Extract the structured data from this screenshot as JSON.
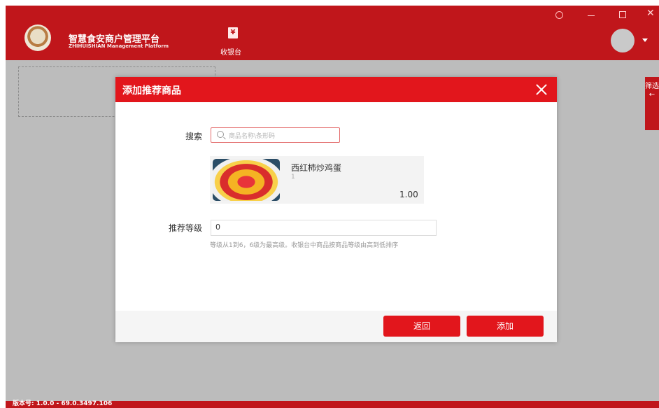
{
  "header": {
    "brand_cn": "智慧食安商户管理平台",
    "brand_en": "ZHIHUISHIAN Management Platform",
    "nav": {
      "icon": "cashier-icon",
      "icon_glyph": "¥",
      "label": "收银台"
    }
  },
  "side_tab": {
    "label": "筛选"
  },
  "footer": {
    "version": "版本号: 1.0.0 - 69.0.3497.106"
  },
  "modal": {
    "title": "添加推荐商品",
    "search": {
      "label": "搜索",
      "placeholder": "商品名称\\条形码"
    },
    "product": {
      "name": "西红柿炒鸡蛋",
      "sub": "1",
      "price": "1.00"
    },
    "level": {
      "label": "推荐等级",
      "value": "0",
      "hint": "等级从1到6，6级为最高级。收银台中商品按商品等级由高到低排序"
    },
    "buttons": {
      "back": "返回",
      "add": "添加"
    }
  },
  "colors": {
    "brand_red": "#c0161b",
    "modal_red": "#e2161c"
  }
}
